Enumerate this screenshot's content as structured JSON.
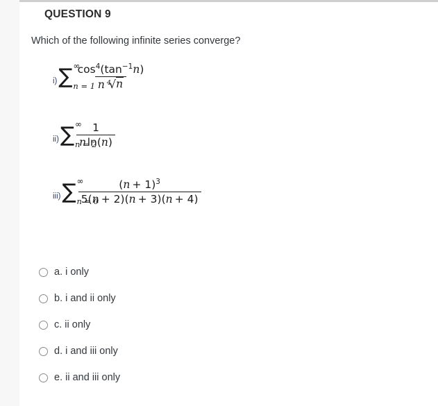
{
  "question": {
    "title": "QUESTION 9",
    "prompt": "Which of the following infinite series converge?"
  },
  "series": [
    {
      "roman": "i)",
      "sigma": "∑",
      "upper": "∞",
      "lower": "n = 1",
      "numerator": "cos⁴(tan⁻¹ n)",
      "denominator": "n ⁴√n",
      "parts": {
        "num_fn": "cos",
        "num_exp": "4",
        "num_inner_fn": "tan",
        "num_inner_exp": "−1",
        "num_var": "n",
        "den_var": "n",
        "den_root_index": "4",
        "den_radicand": "n"
      }
    },
    {
      "roman": "ii)",
      "sigma": "∑",
      "upper": "∞",
      "lower": "n = 2",
      "numerator": "1",
      "denominator": "n ln(n)",
      "parts": {
        "num_const": "1",
        "den_var": "n",
        "den_fn": "ln",
        "den_arg": "n"
      }
    },
    {
      "roman": "iii)",
      "sigma": "∑",
      "upper": "∞",
      "lower": "n = 0",
      "numerator": "(n + 1)³",
      "denominator": "5(n + 2)(n + 3)(n + 4)",
      "parts": {
        "num_var": "n",
        "num_add": "+ 1",
        "num_exp": "3",
        "den_coef": "5",
        "den_f1": "+ 2",
        "den_f2": "+ 3",
        "den_f3": "+ 4",
        "den_var": "n"
      }
    }
  ],
  "options": [
    {
      "id": "a",
      "label": "a. i only"
    },
    {
      "id": "b",
      "label": "b. i and ii only"
    },
    {
      "id": "c",
      "label": "c. ii only"
    },
    {
      "id": "d",
      "label": "d. i and iii only"
    },
    {
      "id": "e",
      "label": "e. ii and iii only"
    }
  ],
  "colors": {
    "page_background": "#f7f7f7",
    "content_background": "#ffffff",
    "top_border": "#cfcfcf",
    "title_text": "#2b2b2b",
    "body_text": "#32373c",
    "math_text": "#1b1b1b",
    "roman_label": "#2f3f66",
    "radio_border": "#8a8a8a"
  }
}
